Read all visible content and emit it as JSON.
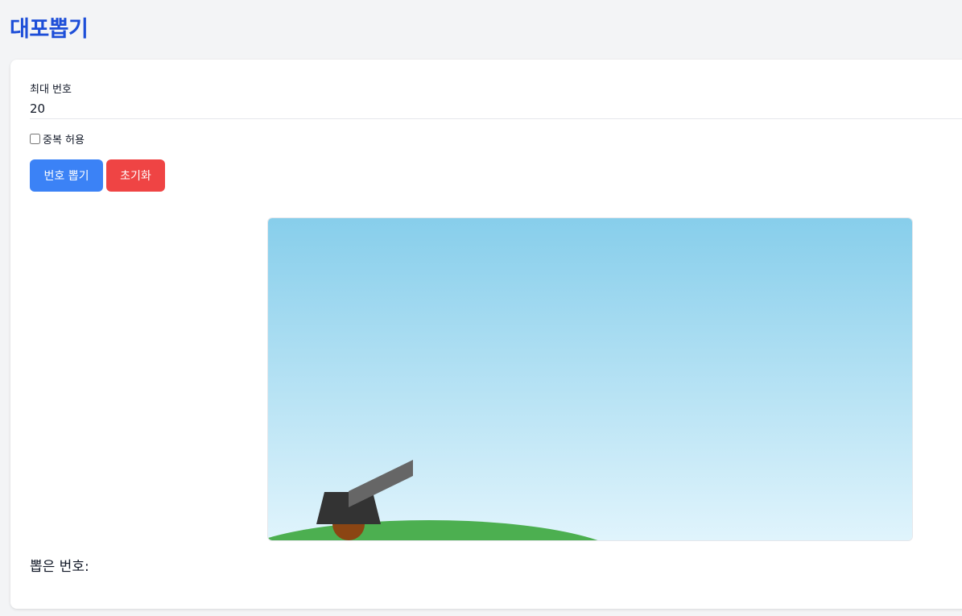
{
  "app": {
    "title": "대포뽑기"
  },
  "form": {
    "max_label": "최대 번호",
    "max_value": "20",
    "duplicate_label": "중복 허용",
    "duplicate_checked": false
  },
  "buttons": {
    "draw_label": "번호 뽑기",
    "reset_label": "초기화"
  },
  "result": {
    "label": "뽑은 번호:"
  },
  "colors": {
    "title": "#1d4ed8",
    "draw_button": "#3b82f6",
    "reset_button": "#ef4444",
    "sky_top": "#87ceeb",
    "sky_bottom": "#e0f4fc",
    "grass": "#4caf50",
    "cannon_base": "#333333",
    "cannon_barrel": "#666666",
    "wheel": "#8b4513"
  }
}
